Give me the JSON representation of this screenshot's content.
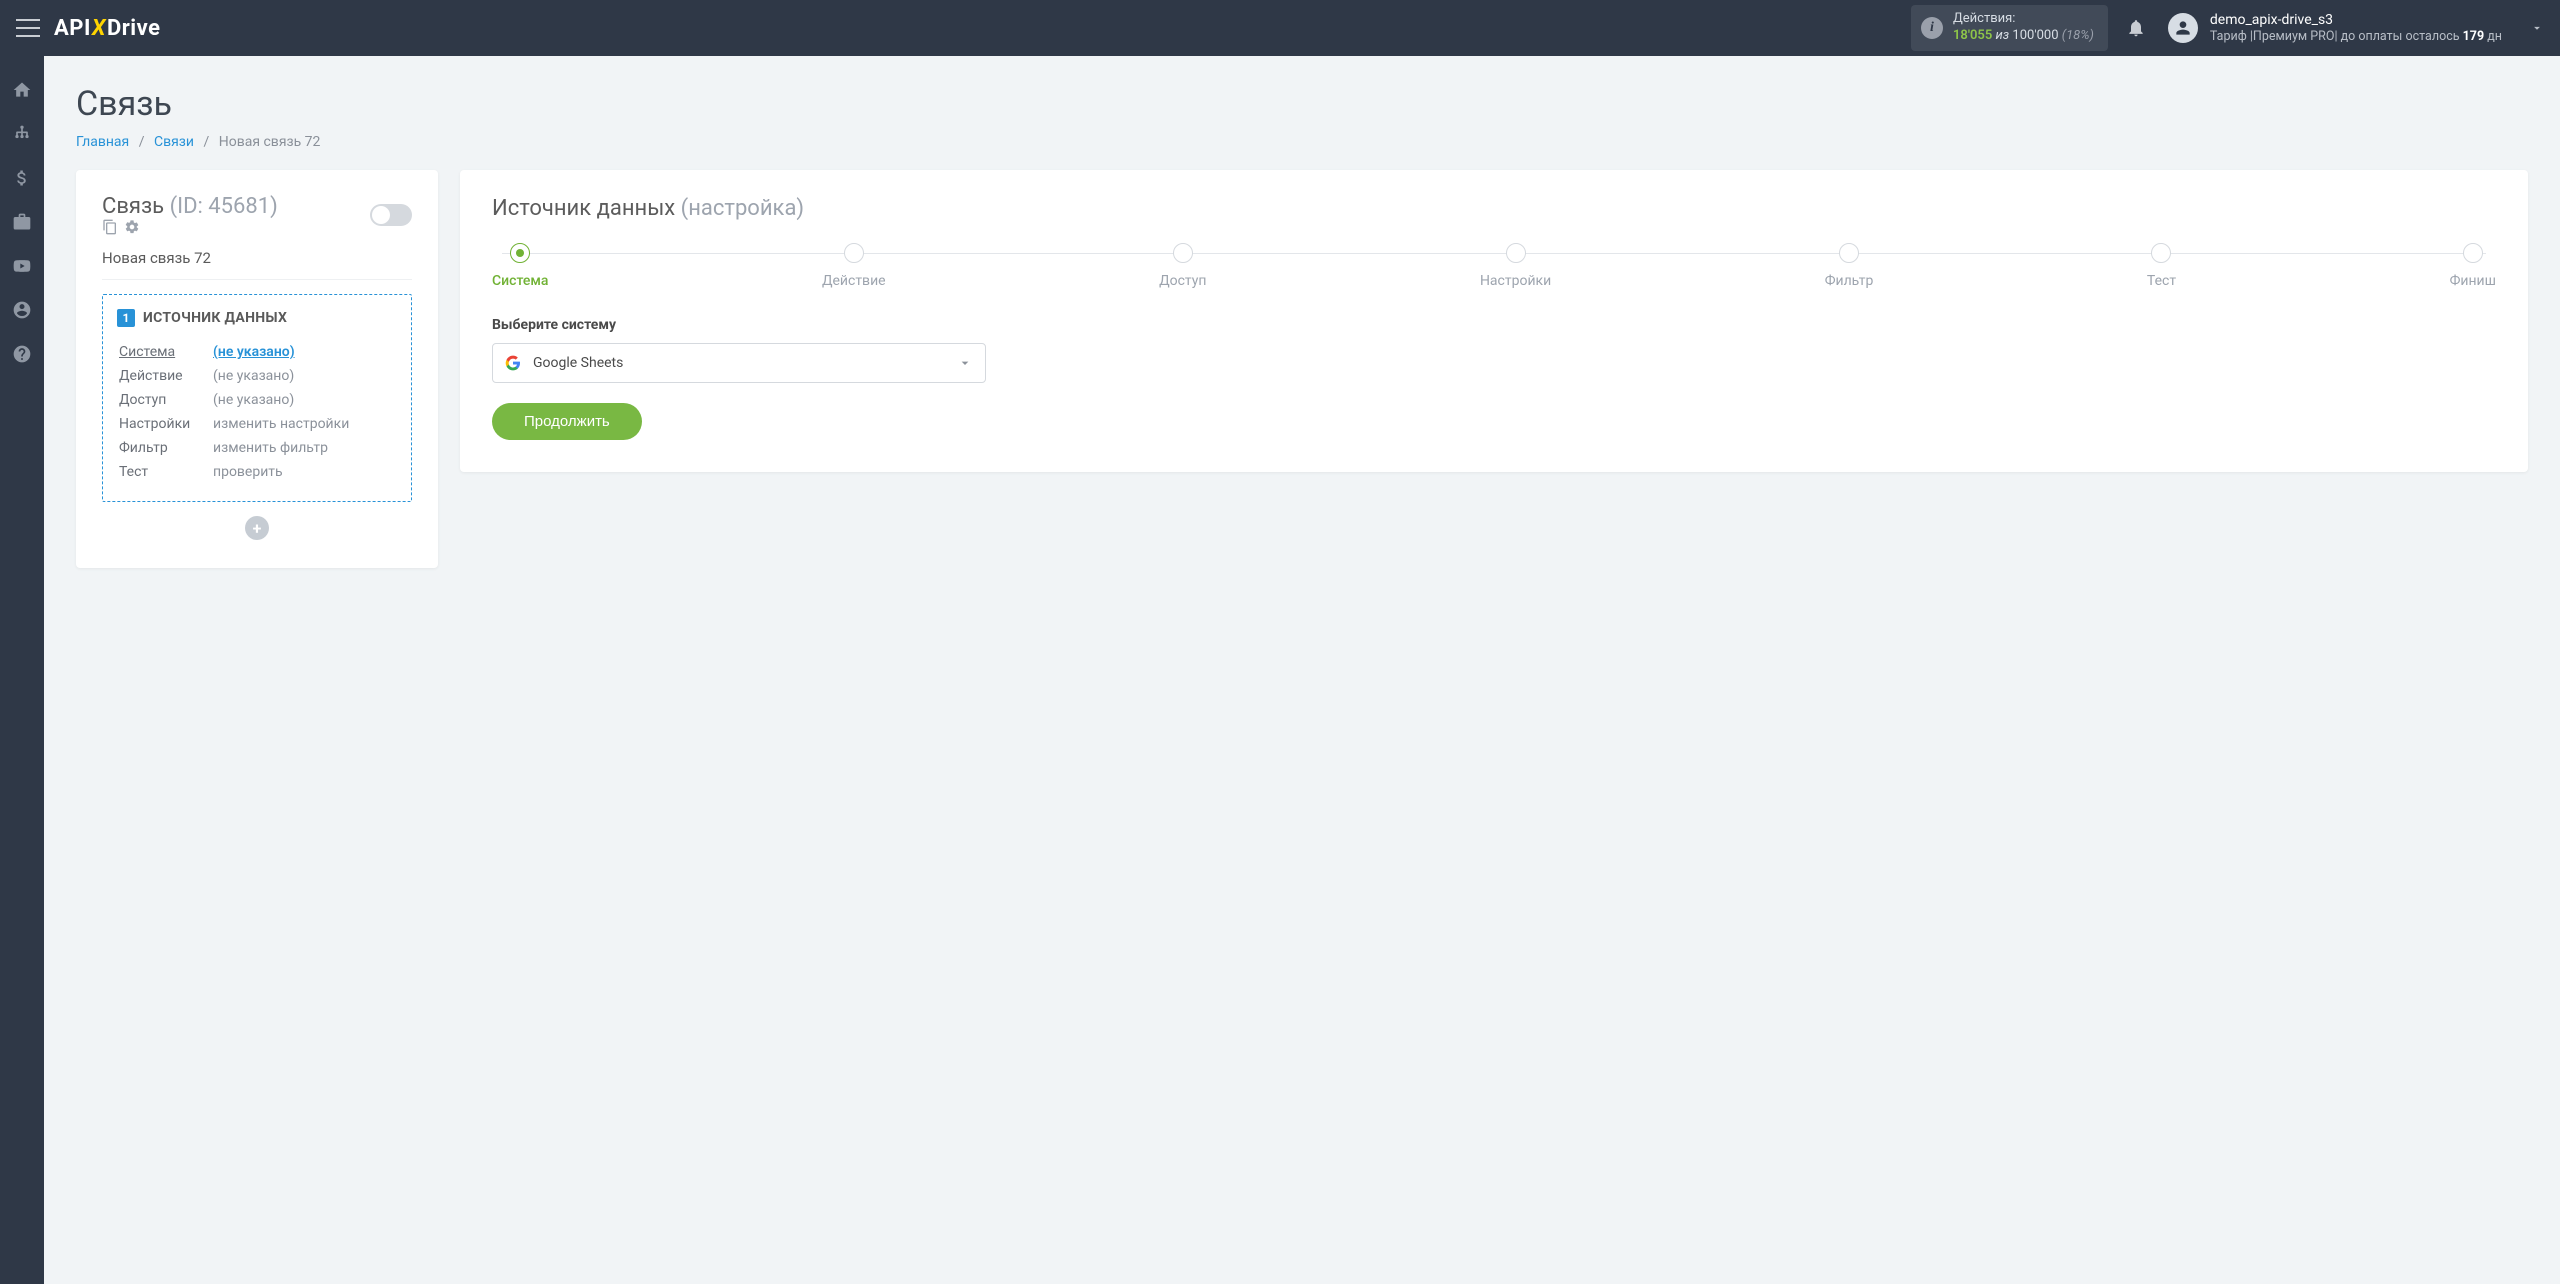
{
  "header": {
    "logo": {
      "api": "API",
      "x": "X",
      "drive": "Drive"
    },
    "actions": {
      "label": "Действия:",
      "used": "18'055",
      "of": "из",
      "limit": "100'000",
      "pct": "(18%)"
    },
    "user": {
      "name": "demo_apix-drive_s3",
      "tariff_prefix": "Тариф |Премиум PRO| до оплаты осталось ",
      "days": "179",
      "days_suffix": " дн"
    }
  },
  "page": {
    "title": "Связь",
    "breadcrumb": {
      "home": "Главная",
      "links": "Связи",
      "current": "Новая связь 72"
    }
  },
  "left_card": {
    "title": "Связь",
    "id_label": "(ID: 45681)",
    "name": "Новая связь 72",
    "source": {
      "num": "1",
      "title": "ИСТОЧНИК ДАННЫХ",
      "rows": [
        {
          "label": "Система",
          "value": "(не указано)",
          "link": true,
          "active": true
        },
        {
          "label": "Действие",
          "value": "(не указано)"
        },
        {
          "label": "Доступ",
          "value": "(не указано)"
        },
        {
          "label": "Настройки",
          "value": "изменить настройки"
        },
        {
          "label": "Фильтр",
          "value": "изменить фильтр"
        },
        {
          "label": "Тест",
          "value": "проверить"
        }
      ]
    },
    "add": "+"
  },
  "right_card": {
    "title": "Источник данных",
    "subtitle": "(настройка)",
    "steps": [
      {
        "label": "Система",
        "active": true
      },
      {
        "label": "Действие"
      },
      {
        "label": "Доступ"
      },
      {
        "label": "Настройки"
      },
      {
        "label": "Фильтр"
      },
      {
        "label": "Тест"
      },
      {
        "label": "Финиш"
      }
    ],
    "field_label": "Выберите систему",
    "selected_system": "Google Sheets",
    "continue": "Продолжить"
  }
}
